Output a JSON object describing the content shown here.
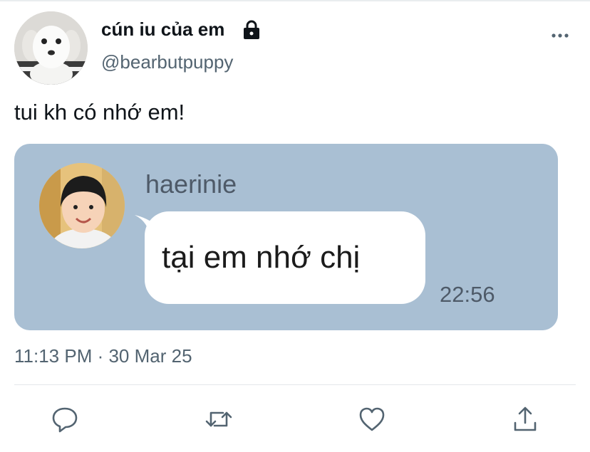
{
  "author": {
    "display_name": "cún iu của em",
    "handle": "@bearbutpuppy",
    "avatar_icon": "puppy-avatar",
    "protected_icon": "lock-icon"
  },
  "tweet": {
    "text": "tui kh có nhớ em!",
    "timestamp": "11:13 PM · 30 Mar 25"
  },
  "media": {
    "background_color": "#a9bfd3",
    "chat": {
      "sender_name": "haerinie",
      "message": "tại em nhớ chị",
      "time": "22:56"
    }
  },
  "menu_icon": "more-horizontal-icon",
  "actions": [
    "reply-icon",
    "retweet-icon",
    "like-icon",
    "share-icon"
  ]
}
